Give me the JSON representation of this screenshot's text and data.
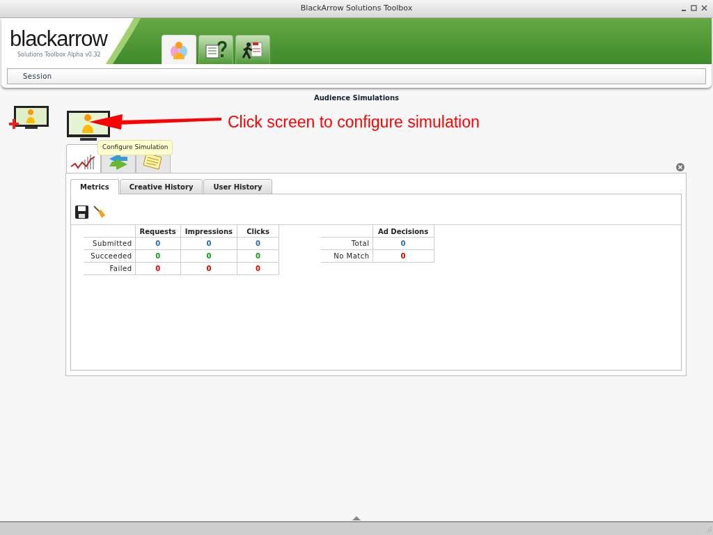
{
  "window": {
    "title": "BlackArrow Solutions Toolbox"
  },
  "logo": {
    "wordmark": "blackarrow",
    "version": "Solutions Toolbox Alpha v0.32"
  },
  "app_tabs": [
    {
      "kind": "people",
      "selected": true
    },
    {
      "kind": "csv",
      "selected": false
    },
    {
      "kind": "runner",
      "selected": false
    }
  ],
  "menu": [
    "Session"
  ],
  "heading": "Audience Simulations",
  "annotation": "Click screen to configure simulation",
  "tooltip": "Configure Simulation",
  "view_tabs": [
    {
      "kind": "chart",
      "selected": true
    },
    {
      "kind": "arrows",
      "selected": false
    },
    {
      "kind": "note",
      "selected": false
    }
  ],
  "sub_tabs": [
    {
      "label": "Metrics",
      "selected": true
    },
    {
      "label": "Creative History",
      "selected": false
    },
    {
      "label": "User History",
      "selected": false
    }
  ],
  "metrics_table": {
    "columns": [
      "Requests",
      "Impressions",
      "Clicks"
    ],
    "rows": [
      {
        "label": "Submitted",
        "cells": [
          {
            "value": "0",
            "color": "#1f6fb5"
          },
          {
            "value": "0",
            "color": "#1f6fb5"
          },
          {
            "value": "0",
            "color": "#1f6fb5"
          }
        ]
      },
      {
        "label": "Succeeded",
        "cells": [
          {
            "value": "0",
            "color": "#10a010"
          },
          {
            "value": "0",
            "color": "#10a010"
          },
          {
            "value": "0",
            "color": "#10a010"
          }
        ]
      },
      {
        "label": "Failed",
        "cells": [
          {
            "value": "0",
            "color": "#e00000"
          },
          {
            "value": "0",
            "color": "#e00000"
          },
          {
            "value": "0",
            "color": "#e00000"
          }
        ]
      }
    ]
  },
  "decisions_table": {
    "columns": [
      "Ad Decisions"
    ],
    "rows": [
      {
        "label": "Total",
        "cells": [
          {
            "value": "0",
            "color": "#1f6fb5"
          }
        ]
      },
      {
        "label": "No Match",
        "cells": [
          {
            "value": "0",
            "color": "#e00000"
          }
        ]
      }
    ]
  }
}
